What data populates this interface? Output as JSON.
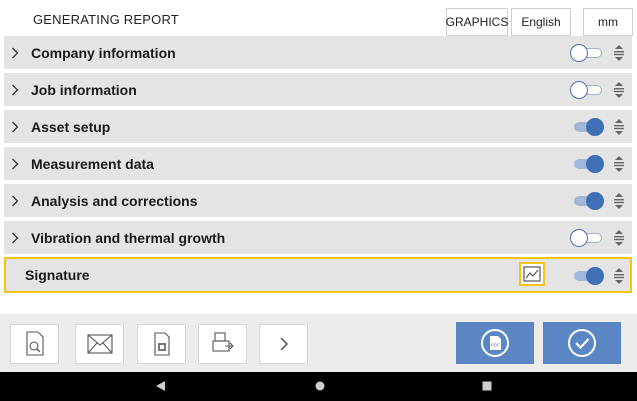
{
  "header": {
    "title": "GENERATING REPORT",
    "graphics_label": "GRAPHICS",
    "language_label": "English",
    "units_label": "mm"
  },
  "sections": [
    {
      "label": "Company information",
      "expandable": true,
      "enabled": false
    },
    {
      "label": "Job information",
      "expandable": true,
      "enabled": false
    },
    {
      "label": "Asset setup",
      "expandable": true,
      "enabled": true
    },
    {
      "label": "Measurement data",
      "expandable": true,
      "enabled": true
    },
    {
      "label": "Analysis and corrections",
      "expandable": true,
      "enabled": true
    },
    {
      "label": "Vibration and thermal growth",
      "expandable": true,
      "enabled": false
    },
    {
      "label": "Signature",
      "expandable": false,
      "enabled": true,
      "selected": true
    }
  ],
  "colors": {
    "accent": "#3f6fb5",
    "selection": "#f0c419",
    "row_bg": "#e4e4e4",
    "primary_button": "#5b86c4"
  },
  "toolbar": {
    "icons": [
      "preview-icon",
      "email-icon",
      "qr-document-icon",
      "export-icon",
      "more-chevron-icon"
    ],
    "actions": [
      "pdf-icon",
      "confirm-check-icon"
    ]
  },
  "navigation": {
    "icons": [
      "back-icon",
      "home-icon",
      "recents-icon"
    ]
  }
}
